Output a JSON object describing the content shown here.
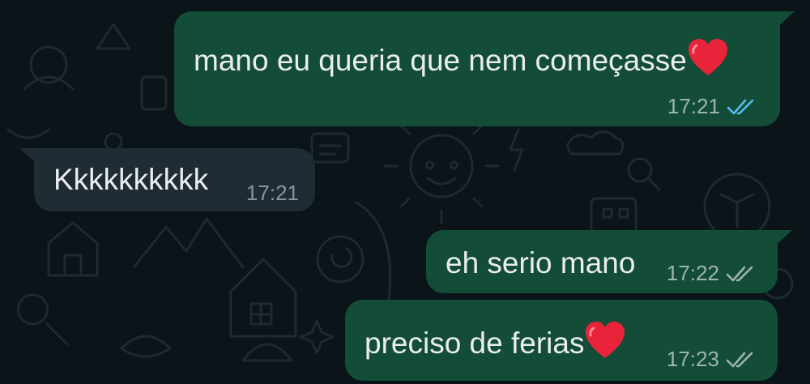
{
  "colors": {
    "background": "#0b1418",
    "outgoing_bubble": "#134d37",
    "incoming_bubble": "#1f2c34",
    "read_ticks": "#53bdeb",
    "delivered_ticks": "#9fb3ae",
    "heart": "#e8233a"
  },
  "messages": [
    {
      "direction": "outgoing",
      "text": "mano eu queria que nem começasse",
      "emoji": "heart-icon",
      "time": "17:21",
      "status": "read",
      "status_icon": "double-check-icon"
    },
    {
      "direction": "incoming",
      "text": "Kkkkkkkkkk",
      "time": "17:21"
    },
    {
      "direction": "outgoing",
      "text": "eh serio mano",
      "time": "17:22",
      "status": "delivered",
      "status_icon": "double-check-icon"
    },
    {
      "direction": "outgoing",
      "text": "preciso de ferias",
      "emoji": "heart-icon",
      "time": "17:23",
      "status": "delivered",
      "status_icon": "double-check-icon"
    }
  ]
}
